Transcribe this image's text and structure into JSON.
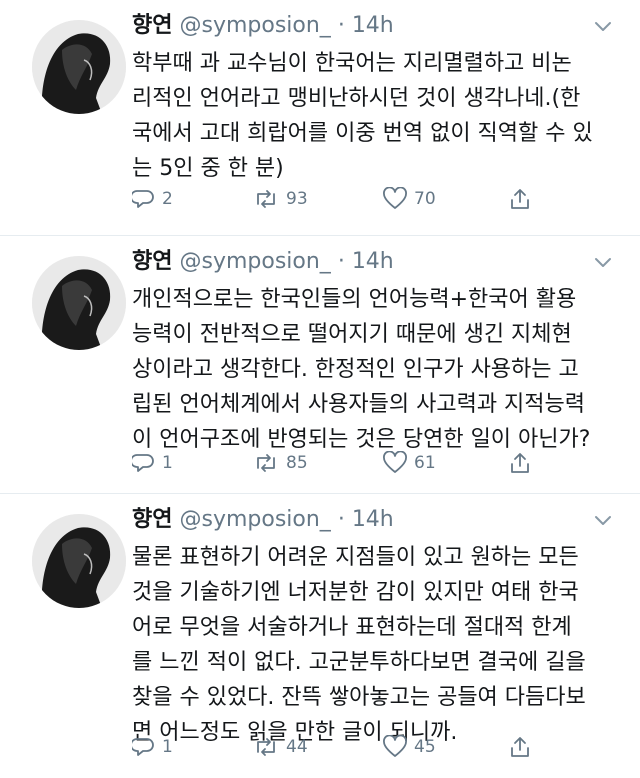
{
  "tweets": [
    {
      "author_name": "향연",
      "handle": "@symposion_",
      "separator": "·",
      "time": "14h",
      "text": "학부때 과 교수님이 한국어는 지리멸렬하고 비논\n리적인 언어라고 맹비난하시던 것이 생각나네.(한\n국에서 고대 희랍어를 이중 번역 없이 직역할 수 있\n는 5인 중 한 분)",
      "replies": "2",
      "retweets": "93",
      "likes": "70"
    },
    {
      "author_name": "향연",
      "handle": "@symposion_",
      "separator": "·",
      "time": "14h",
      "text": "개인적으로는 한국인들의 언어능력+한국어 활용\n능력이 전반적으로 떨어지기 때문에 생긴 지체현\n상이라고 생각한다. 한정적인 인구가 사용하는 고\n립된 언어체계에서 사용자들의 사고력과 지적능력\n이 언어구조에 반영되는 것은 당연한 일이 아닌가?",
      "replies": "1",
      "retweets": "85",
      "likes": "61"
    },
    {
      "author_name": "향연",
      "handle": "@symposion_",
      "separator": "·",
      "time": "14h",
      "text": "물론 표현하기 어려운 지점들이 있고 원하는 모든\n것을 기술하기엔 너저분한 감이 있지만 여태 한국\n어로 무엇을 서술하거나 표현하는데 절대적 한계\n를 느낀 적이 없다. 고군분투하다보면 결국에 길을\n찾을 수 있었다. 잔뜩 쌓아놓고는 공들여 다듬다보\n면 어느정도 읽을 만한 글이 되니까.",
      "replies": "1",
      "retweets": "44",
      "likes": "45"
    }
  ],
  "icons": {
    "reply": "reply-icon",
    "retweet": "retweet-icon",
    "like": "heart-icon",
    "share": "share-icon",
    "menu": "chevron-down-icon",
    "avatar": "avatar"
  },
  "colors": {
    "text": "#14171a",
    "secondary": "#657786",
    "divider": "#e6ecf0"
  }
}
